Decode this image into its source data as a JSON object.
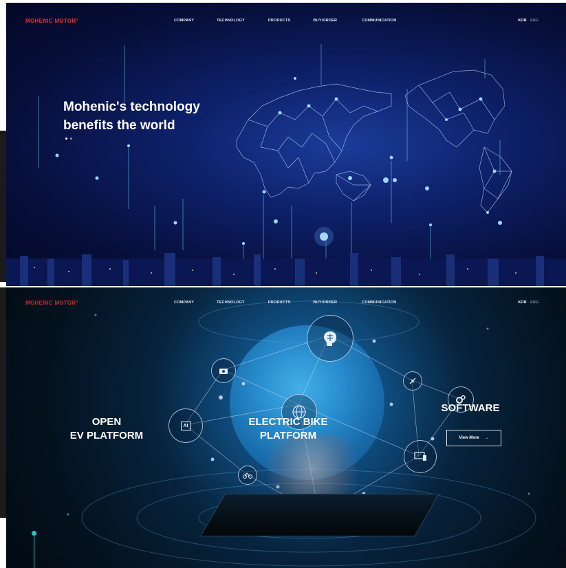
{
  "section1": {
    "nav": {
      "logo": "MOHENIC MOTOR°",
      "menu": [
        "COMPANY",
        "TECHNOLOGY",
        "PRODUCTS",
        "BUY/ORDER",
        "COMMUNICATION"
      ],
      "lang_kor": "KOR",
      "lang_eng": "ENG"
    },
    "hero": {
      "title_line1": "Mohenic's technology",
      "title_line2": "benefits the world"
    },
    "pager": {
      "count": 2,
      "active": 0
    }
  },
  "section2": {
    "nav": {
      "logo": "MOHENIC MOTOR°",
      "menu": [
        "COMPANY",
        "TECHNOLOGY",
        "PRODUCTS",
        "BUY/ORDER",
        "COMMUNICATION"
      ],
      "lang_kor": "KOR",
      "lang_eng": "ENG"
    },
    "open_platform": {
      "line1": "OPEN",
      "line2": "EV PLATFORM"
    },
    "ebike_platform": {
      "line1": "ELECTRIC BIKE",
      "line2": "PLATFORM"
    },
    "software": {
      "label": "SOFTWARE",
      "button": "View More",
      "button_arrow": "→"
    },
    "node_ai_label": "AI"
  },
  "colors": {
    "logo_red": "#e5302d",
    "accent_cyan": "#2bc4c4",
    "hero_blue": "#0d2068"
  },
  "icons": [
    "brain-icon",
    "globe-icon",
    "ai-chip-icon",
    "satellite-icon",
    "bicycle-icon",
    "camera-icon",
    "devices-icon",
    "gears-icon",
    "arrow-right-icon"
  ]
}
